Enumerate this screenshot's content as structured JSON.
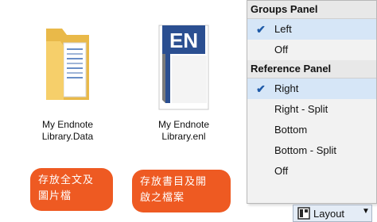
{
  "files": [
    {
      "name_line1": "My Endnote",
      "name_line2": "Library.Data",
      "icon": "folder-icon"
    },
    {
      "name_line1": "My Endnote",
      "name_line2": "Library.enl",
      "icon": "endnote-file-icon",
      "badge": "EN"
    }
  ],
  "callouts": [
    {
      "line1": "存放全文及",
      "line2": "圖片檔"
    },
    {
      "line1": "存放書目及開",
      "line2": "啟之檔案"
    }
  ],
  "menu": {
    "groups_header": "Groups Panel",
    "groups_items": [
      {
        "label": "Left",
        "checked": true
      },
      {
        "label": "Off",
        "checked": false
      }
    ],
    "reference_header": "Reference Panel",
    "reference_items": [
      {
        "label": "Right",
        "checked": true
      },
      {
        "label": "Right - Split",
        "checked": false
      },
      {
        "label": "Bottom",
        "checked": false
      },
      {
        "label": "Bottom - Split",
        "checked": false
      },
      {
        "label": "Off",
        "checked": false
      }
    ]
  },
  "layout_button": {
    "label": "Layout",
    "icon": "layout-panel-icon",
    "arrow": "dropdown-arrow-icon"
  },
  "colors": {
    "callout": "#ee5a22",
    "check": "#1e5aa8",
    "endnote_blue": "#2b4f91"
  }
}
